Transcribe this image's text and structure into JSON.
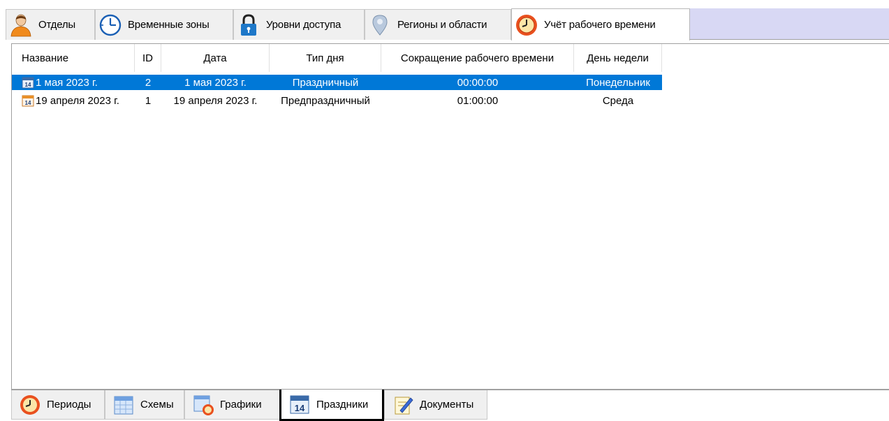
{
  "top_tabs": [
    {
      "label": "Отделы",
      "icon": "user-icon"
    },
    {
      "label": "Временные зоны",
      "icon": "clock-icon"
    },
    {
      "label": "Уровни доступа",
      "icon": "lock-icon"
    },
    {
      "label": "Регионы и области",
      "icon": "pin-icon"
    },
    {
      "label": "Учёт рабочего времени",
      "icon": "timesheet-clock-icon",
      "active": true
    }
  ],
  "table": {
    "columns": [
      "Название",
      "ID",
      "Дата",
      "Тип дня",
      "Сокращение рабочего времени",
      "День недели"
    ],
    "rows": [
      {
        "name": "1 мая 2023 г.",
        "id": "2",
        "date": "1 мая 2023 г.",
        "day_type": "Праздничный",
        "reduction": "00:00:00",
        "weekday": "Понедельник",
        "selected": true
      },
      {
        "name": "19 апреля 2023 г.",
        "id": "1",
        "date": "19 апреля 2023 г.",
        "day_type": "Предпраздничный",
        "reduction": "01:00:00",
        "weekday": "Среда",
        "selected": false
      }
    ]
  },
  "bottom_tabs": [
    {
      "label": "Периоды",
      "icon": "periods-clock-icon"
    },
    {
      "label": "Схемы",
      "icon": "calendar-grid-icon"
    },
    {
      "label": "Графики",
      "icon": "schedule-icon"
    },
    {
      "label": "Праздники",
      "icon": "calendar-14-icon",
      "active": true
    },
    {
      "label": "Документы",
      "icon": "document-pen-icon"
    }
  ],
  "colors": {
    "selection": "#0078d7",
    "strip_fill": "#d8d8f4",
    "active_outline": "#000000"
  }
}
